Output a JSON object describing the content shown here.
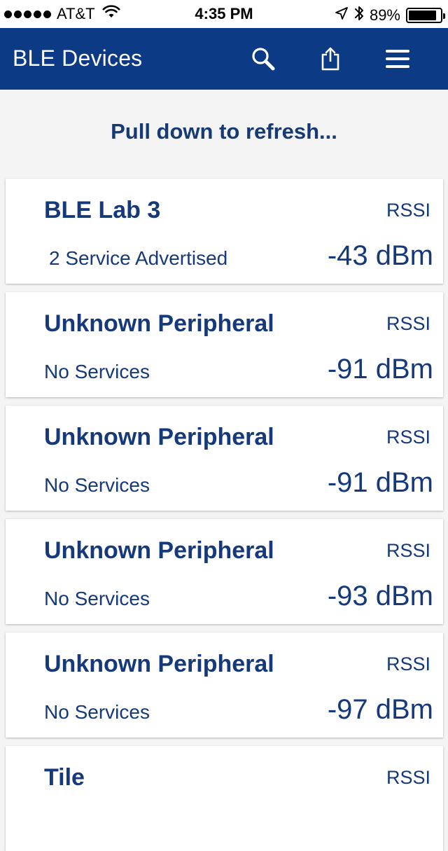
{
  "status_bar": {
    "carrier": "AT&T",
    "time": "4:35 PM",
    "battery_percent": "89%",
    "battery_level": 0.89
  },
  "nav": {
    "title": "BLE Devices",
    "icons": [
      "search-icon",
      "share-icon",
      "menu-icon"
    ]
  },
  "refresh": {
    "label": "Pull down to refresh..."
  },
  "devices": [
    {
      "name": "BLE Lab 3",
      "services": "2 Service Advertised",
      "rssi_label": "RSSI",
      "rssi": "-43 dBm"
    },
    {
      "name": "Unknown Peripheral",
      "services": "No Services",
      "rssi_label": "RSSI",
      "rssi": "-91 dBm"
    },
    {
      "name": "Unknown Peripheral",
      "services": "No Services",
      "rssi_label": "RSSI",
      "rssi": "-91 dBm"
    },
    {
      "name": "Unknown Peripheral",
      "services": "No Services",
      "rssi_label": "RSSI",
      "rssi": "-93 dBm"
    },
    {
      "name": "Unknown Peripheral",
      "services": "No Services",
      "rssi_label": "RSSI",
      "rssi": "-97 dBm"
    },
    {
      "name": "Tile",
      "services": "",
      "rssi_label": "RSSI",
      "rssi": ""
    }
  ],
  "colors": {
    "nav_background": "#0d3a84",
    "text_primary": "#15397a",
    "page_background": "#f4f4f4"
  }
}
